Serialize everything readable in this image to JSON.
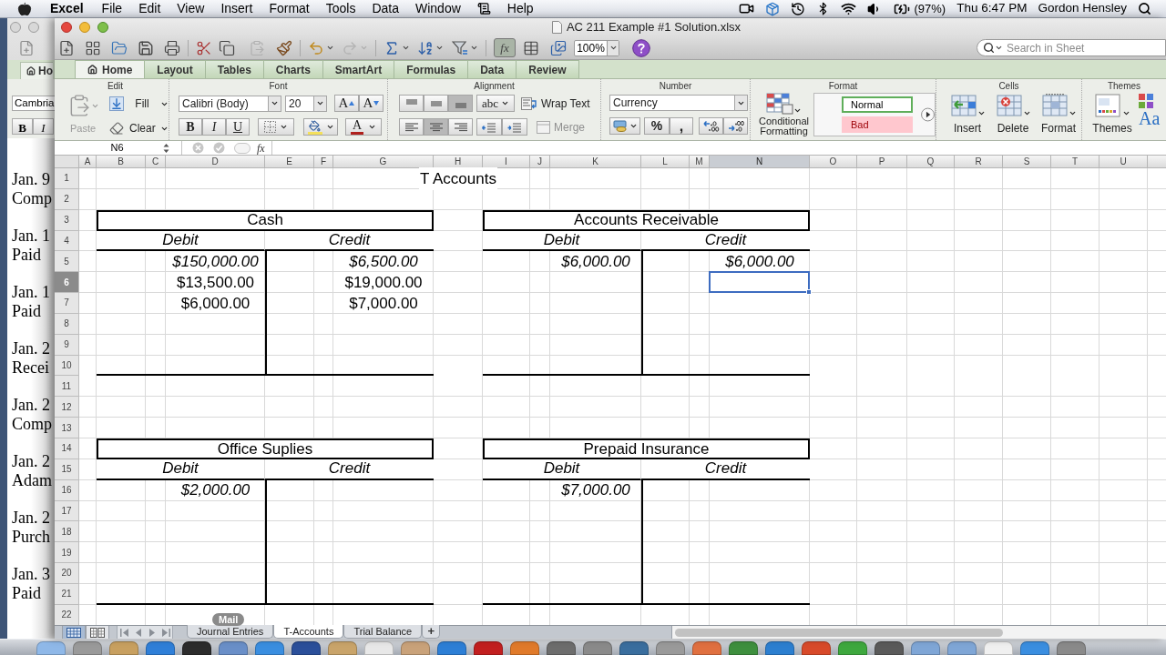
{
  "menu_bar": {
    "app_name": "Excel",
    "menus": [
      "File",
      "Edit",
      "View",
      "Insert",
      "Format",
      "Tools",
      "Data",
      "Window",
      "Help"
    ],
    "battery": "(97%)",
    "clock": "Thu 6:47 PM",
    "user": "Gordon Hensley"
  },
  "background_window": {
    "tab": "Ho",
    "font": "Cambria",
    "buttons": [
      {
        "label": "B",
        "kind": "bold"
      },
      {
        "label": "I",
        "kind": "italic"
      }
    ],
    "document": [
      {
        "lines": [
          "Jan. 9",
          "Comp"
        ]
      },
      {
        "lines": [
          "Jan. 1",
          "Paid"
        ]
      },
      {
        "lines": [
          "Jan. 1",
          "Paid"
        ]
      },
      {
        "lines": [
          "Jan. 2",
          "Recei"
        ]
      },
      {
        "lines": [
          "Jan. 2",
          "Comp"
        ]
      },
      {
        "lines": [
          "Jan. 2",
          "Adam"
        ]
      },
      {
        "lines": [
          "Jan. 2",
          "Purch"
        ]
      },
      {
        "lines": [
          "Jan. 3",
          "Paid"
        ]
      }
    ]
  },
  "window": {
    "title": "AC 211 Example #1 Solution.xlsx",
    "toolbar": {
      "paste": {
        "disabled": true
      },
      "redo": {
        "disabled": true
      },
      "formula_builder": {
        "label": "fx",
        "pressed": true
      },
      "zoom": "100%",
      "search": {
        "placeholder": "Search in Sheet"
      }
    },
    "ribbon": {
      "tabs": [
        {
          "label": "Home",
          "selected": true
        },
        {
          "label": "Layout",
          "selected": false
        },
        {
          "label": "Tables",
          "selected": false
        },
        {
          "label": "Charts",
          "selected": false
        },
        {
          "label": "SmartArt",
          "selected": false
        },
        {
          "label": "Formulas",
          "selected": false
        },
        {
          "label": "Data",
          "selected": false
        },
        {
          "label": "Review",
          "selected": false
        }
      ],
      "edit": {
        "title": "Edit",
        "paste": {
          "label": "Paste",
          "disabled": true
        },
        "fill": "Fill",
        "clear": "Clear"
      },
      "font": {
        "title": "Font",
        "family": "Calibri (Body)",
        "size": "20",
        "grow": "A",
        "shrink": "A",
        "styles": [
          {
            "label": "B",
            "kind": "bold"
          },
          {
            "label": "I",
            "kind": "italic"
          },
          {
            "label": "U",
            "kind": "underline"
          }
        ],
        "foreground": "A"
      },
      "alignment": {
        "title": "Alignment",
        "vertical": [
          {
            "kind": "top",
            "selected": false
          },
          {
            "kind": "middle",
            "selected": false
          },
          {
            "kind": "bottom",
            "selected": true
          }
        ],
        "horizontal": [
          {
            "kind": "left",
            "selected": false
          },
          {
            "kind": "center",
            "selected": true
          },
          {
            "kind": "right",
            "selected": false
          }
        ],
        "orientation": "abc",
        "wrap_text": "Wrap Text",
        "merge": {
          "label": "Merge",
          "disabled": true
        }
      },
      "number": {
        "title": "Number",
        "format": "Currency",
        "percent": "%",
        "comma": ","
      },
      "format": {
        "title": "Format",
        "conditional": "Conditional Formatting",
        "styles": [
          {
            "label": "Normal",
            "kind": "normal"
          },
          {
            "label": "Bad",
            "kind": "bad"
          }
        ]
      },
      "cells": {
        "title": "Cells",
        "buttons": [
          {
            "label": "Insert",
            "kind": "insert"
          },
          {
            "label": "Delete",
            "kind": "delete"
          },
          {
            "label": "Format",
            "kind": "format"
          }
        ]
      },
      "themes": {
        "title": "Themes",
        "button": "Themes",
        "fonts": "Aa"
      }
    },
    "formula_bar": {
      "name_box": "N6",
      "function_label": "fx"
    },
    "sheet": {
      "columns": [
        {
          "label": "A",
          "selected": false
        },
        {
          "label": "B",
          "selected": false
        },
        {
          "label": "C",
          "selected": false
        },
        {
          "label": "D",
          "selected": false
        },
        {
          "label": "E",
          "selected": false
        },
        {
          "label": "F",
          "selected": false
        },
        {
          "label": "G",
          "selected": false
        },
        {
          "label": "H",
          "selected": false
        },
        {
          "label": "I",
          "selected": false
        },
        {
          "label": "J",
          "selected": false
        },
        {
          "label": "K",
          "selected": false
        },
        {
          "label": "L",
          "selected": false
        },
        {
          "label": "M",
          "selected": false
        },
        {
          "label": "N",
          "selected": true
        },
        {
          "label": "O",
          "selected": false
        },
        {
          "label": "P",
          "selected": false
        },
        {
          "label": "Q",
          "selected": false
        },
        {
          "label": "R",
          "selected": false
        },
        {
          "label": "S",
          "selected": false
        },
        {
          "label": "T",
          "selected": false
        },
        {
          "label": "U",
          "selected": false
        }
      ],
      "rows": [
        {
          "label": "1",
          "selected": false
        },
        {
          "label": "2",
          "selected": false
        },
        {
          "label": "3",
          "selected": false
        },
        {
          "label": "4",
          "selected": false
        },
        {
          "label": "5",
          "selected": false
        },
        {
          "label": "6",
          "selected": true
        },
        {
          "label": "7",
          "selected": false
        },
        {
          "label": "8",
          "selected": false
        },
        {
          "label": "9",
          "selected": false
        },
        {
          "label": "10",
          "selected": false
        },
        {
          "label": "11",
          "selected": false
        },
        {
          "label": "12",
          "selected": false
        },
        {
          "label": "13",
          "selected": false
        },
        {
          "label": "14",
          "selected": false
        },
        {
          "label": "15",
          "selected": false
        },
        {
          "label": "16",
          "selected": false
        },
        {
          "label": "17",
          "selected": false
        },
        {
          "label": "18",
          "selected": false
        },
        {
          "label": "19",
          "selected": false
        },
        {
          "label": "20",
          "selected": false
        },
        {
          "label": "21",
          "selected": false
        },
        {
          "label": "22",
          "selected": false
        }
      ],
      "heading": "T Accounts",
      "accounts": [
        {
          "name": "Cash",
          "debit_label": "Debit",
          "credit_label": "Credit",
          "debits": [
            {
              "value": "$150,000.00",
              "italic": true
            },
            {
              "value": "$13,500.00",
              "italic": false
            },
            {
              "value": "$6,000.00",
              "italic": false
            }
          ],
          "credits": [
            {
              "value": "$6,500.00",
              "italic": true
            },
            {
              "value": "$19,000.00",
              "italic": false
            },
            {
              "value": "$7,000.00",
              "italic": false
            }
          ]
        },
        {
          "name": "Accounts Receivable",
          "debit_label": "Debit",
          "credit_label": "Credit",
          "debits": [
            {
              "value": "$6,000.00",
              "italic": true
            }
          ],
          "credits": [
            {
              "value": "$6,000.00",
              "italic": true
            }
          ]
        },
        {
          "name": "Office Suplies",
          "debit_label": "Debit",
          "credit_label": "Credit",
          "debits": [
            {
              "value": "$2,000.00",
              "italic": true
            }
          ]
        },
        {
          "name": "Prepaid Insurance",
          "debit_label": "Debit",
          "credit_label": "Credit",
          "debits": [
            {
              "value": "$7,000.00",
              "italic": true
            }
          ]
        }
      ]
    },
    "views": [
      {
        "kind": "normal",
        "selected": true
      },
      {
        "kind": "page_layout",
        "selected": false
      }
    ],
    "sheet_tabs": [
      {
        "label": "Journal Entries",
        "selected": false
      },
      {
        "label": "T-Accounts",
        "selected": true
      },
      {
        "label": "Trial Balance",
        "selected": false
      }
    ],
    "add_sheet": "+"
  },
  "dock": {
    "tooltip": "Mail"
  }
}
